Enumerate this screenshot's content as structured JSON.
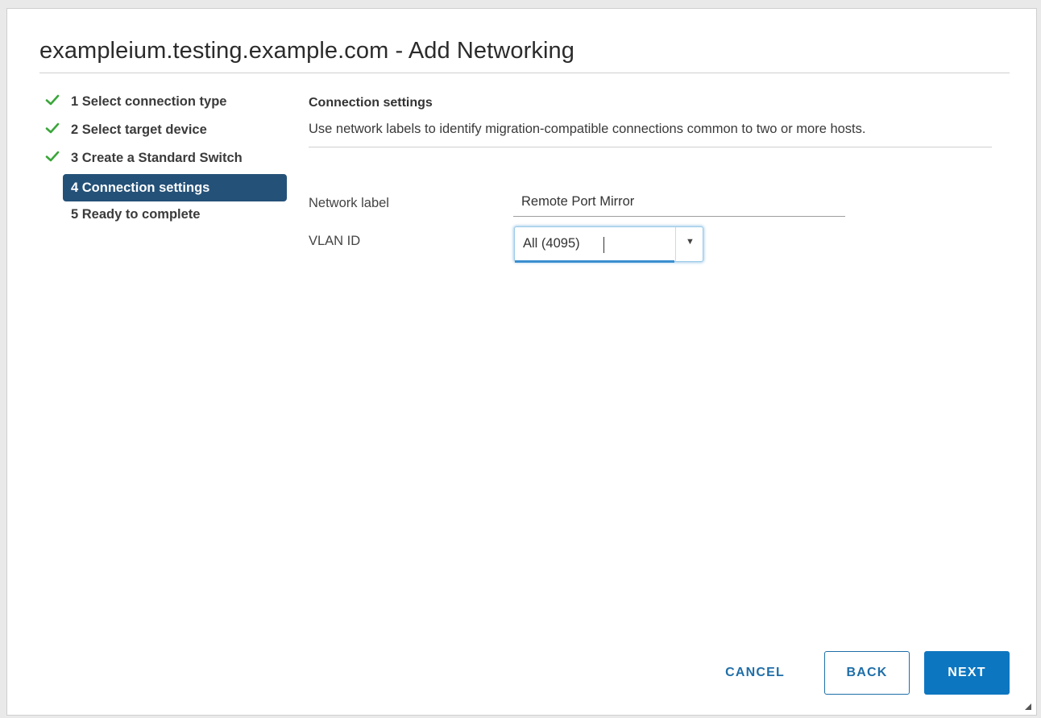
{
  "dialog": {
    "title": "exampleium.testing.example.com - Add Networking"
  },
  "steps": [
    {
      "label": "1 Select connection type",
      "completed": true
    },
    {
      "label": "2 Select target device",
      "completed": true
    },
    {
      "label": "3 Create a Standard Switch",
      "completed": true
    },
    {
      "label": "4 Connection settings",
      "active": true
    },
    {
      "label": "5 Ready to complete"
    }
  ],
  "content": {
    "section_title": "Connection settings",
    "description": "Use network labels to identify migration-compatible connections common to two or more hosts.",
    "network_label": {
      "label": "Network label",
      "value": "Remote Port Mirror"
    },
    "vlan_id": {
      "label": "VLAN ID",
      "value": "All (4095)"
    }
  },
  "buttons": {
    "cancel": "CANCEL",
    "back": "BACK",
    "next": "NEXT"
  },
  "colors": {
    "accent": "#0d76c0",
    "active_step_bg": "#245178",
    "check": "#3aa63a"
  }
}
